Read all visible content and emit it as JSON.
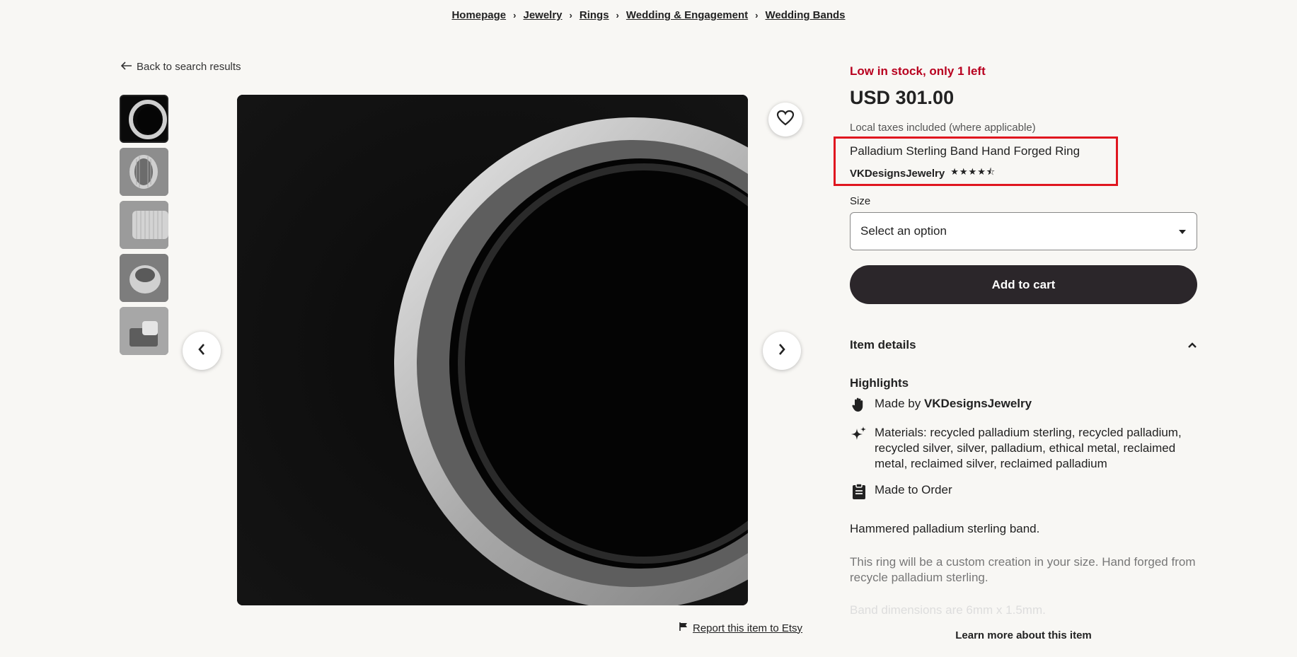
{
  "breadcrumb": {
    "items": [
      "Homepage",
      "Jewelry",
      "Rings",
      "Wedding & Engagement",
      "Wedding Bands"
    ],
    "separator": "›"
  },
  "back_link": {
    "label": "Back to search results",
    "icon": "arrow-left-icon"
  },
  "gallery": {
    "thumbnail_count": 5,
    "active_index": 0,
    "prev_icon": "chevron-left-icon",
    "next_icon": "chevron-right-icon",
    "favorite_icon": "heart-icon"
  },
  "report": {
    "label": "Report this item to Etsy",
    "icon": "flag-icon"
  },
  "product": {
    "stock_note": "Low in stock, only 1 left",
    "price": "USD 301.00",
    "tax_note": "Local taxes included (where applicable)",
    "title": "Palladium Sterling Band Hand Forged Ring",
    "shop_name": "VKDesignsJewelry",
    "rating": 4.5,
    "rating_stars": "★★★★⯪",
    "size_label": "Size",
    "size_select": "Select an option",
    "add_to_cart": "Add to cart"
  },
  "details": {
    "header": "Item details",
    "highlights_title": "Highlights",
    "made_by_prefix": "Made by ",
    "made_by_shop": "VKDesignsJewelry",
    "materials": "Materials: recycled palladium sterling, recycled palladium, recycled silver, silver, palladium, ethical metal, reclaimed metal, reclaimed silver, reclaimed palladium",
    "made_to_order": "Made to Order",
    "description_1": "Hammered palladium sterling band.",
    "description_2": "This ring will be a custom creation in your size. Hand forged from recycle palladium sterling.",
    "description_3": "Band dimensions are 6mm x 1.5mm.",
    "learn_more": "Learn more about this item"
  },
  "colors": {
    "stock_red": "#b8001f",
    "cart_button": "#2b262a",
    "highlight_box": "#e0161f",
    "background": "#f8f7f4"
  }
}
